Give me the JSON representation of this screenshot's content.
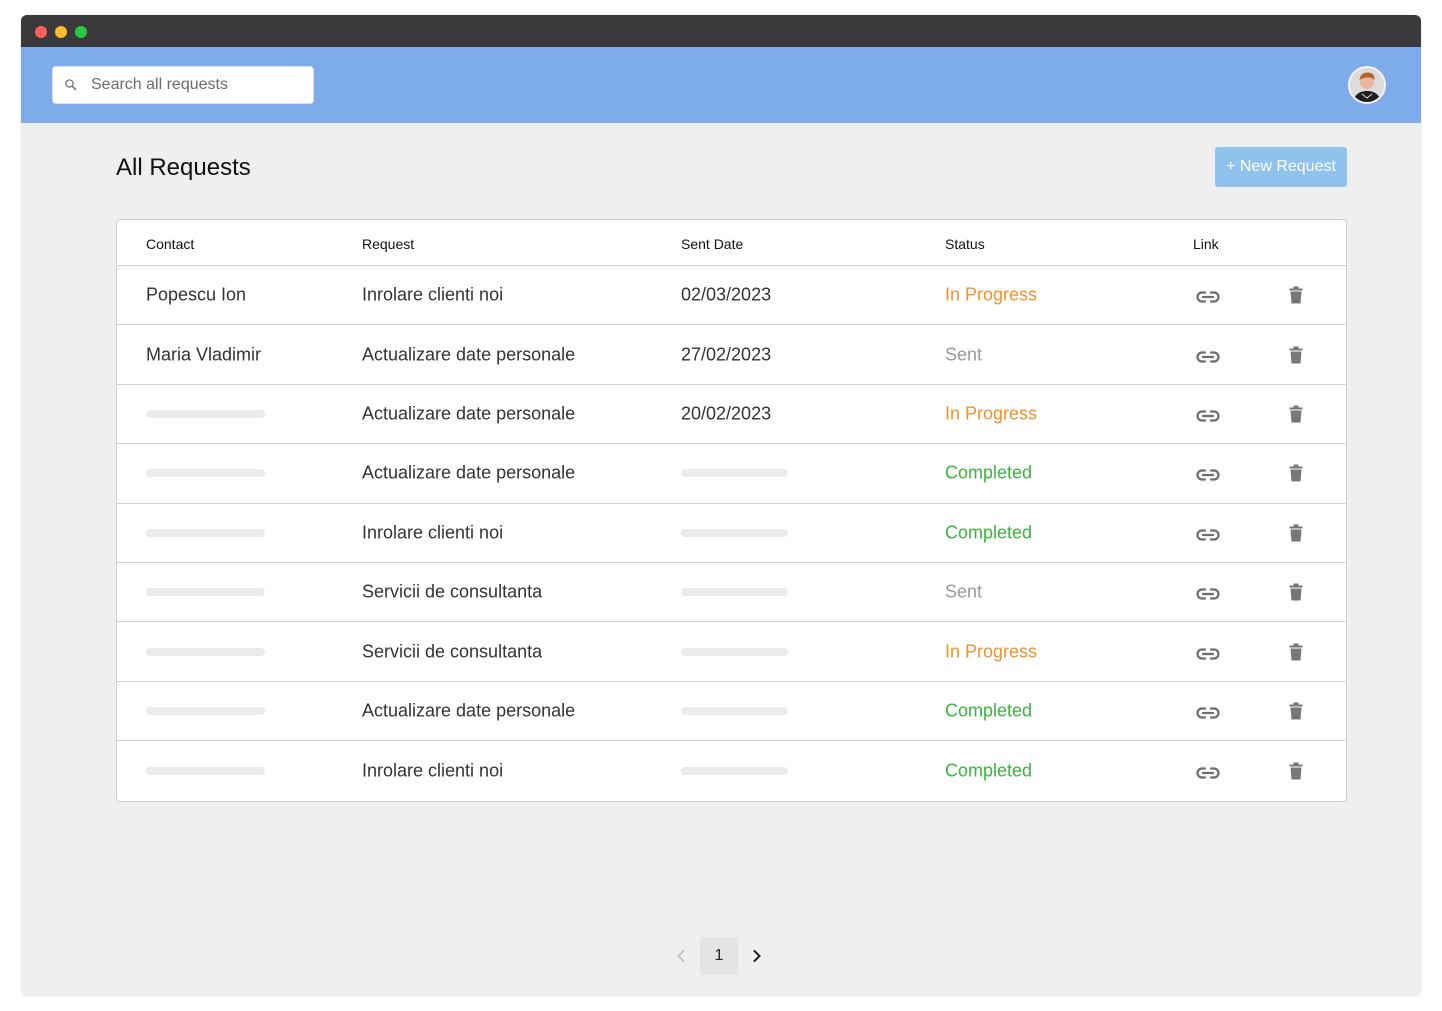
{
  "search": {
    "placeholder": "Search all requests",
    "icon": "search-icon"
  },
  "header": {
    "avatar_icon": "user-avatar"
  },
  "page": {
    "title": "All Requests",
    "new_request_label": "+ New Request"
  },
  "colors": {
    "topbar": "#7eacea",
    "button": "#8fc3ee",
    "in_progress": "#f0922b",
    "sent": "#9a9a9a",
    "completed": "#3bb33d"
  },
  "table": {
    "columns": {
      "contact": "Contact",
      "request": "Request",
      "sent_date": "Sent Date",
      "status": "Status",
      "link": "Link"
    },
    "rows": [
      {
        "contact": "Popescu Ion",
        "request": "Inrolare clienti noi",
        "sent_date": "02/03/2023",
        "status": "In Progress"
      },
      {
        "contact": "Maria Vladimir",
        "request": "Actualizare date personale",
        "sent_date": "27/02/2023",
        "status": "Sent"
      },
      {
        "contact": "",
        "request": "Actualizare date personale",
        "sent_date": "20/02/2023",
        "status": "In Progress"
      },
      {
        "contact": "",
        "request": "Actualizare date personale",
        "sent_date": "",
        "status": "Completed"
      },
      {
        "contact": "",
        "request": "Inrolare clienti noi",
        "sent_date": "",
        "status": "Completed"
      },
      {
        "contact": "",
        "request": "Servicii de consultanta",
        "sent_date": "",
        "status": "Sent"
      },
      {
        "contact": "",
        "request": "Servicii de consultanta",
        "sent_date": "",
        "status": "In Progress"
      },
      {
        "contact": "",
        "request": "Actualizare date personale",
        "sent_date": "",
        "status": "Completed"
      },
      {
        "contact": "",
        "request": "Inrolare clienti noi",
        "sent_date": "",
        "status": "Completed"
      }
    ]
  },
  "pagination": {
    "current_page": "1"
  }
}
